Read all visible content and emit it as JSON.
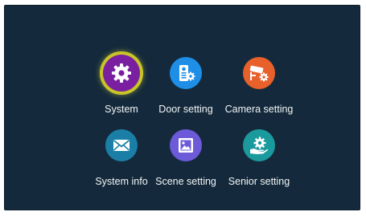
{
  "menu": {
    "items": [
      {
        "label": "System",
        "icon": "gear-icon",
        "color": "#7a1fa0",
        "selected": true
      },
      {
        "label": "Door setting",
        "icon": "door-phone-icon",
        "color": "#1e8ee6",
        "selected": false
      },
      {
        "label": "Camera setting",
        "icon": "security-camera-icon",
        "color": "#e8602a",
        "selected": false
      },
      {
        "label": "System info",
        "icon": "envelope-icon",
        "color": "#1b7ea6",
        "selected": false
      },
      {
        "label": "Scene setting",
        "icon": "picture-icon",
        "color": "#6c5ad8",
        "selected": false
      },
      {
        "label": "Senior setting",
        "icon": "hand-gear-icon",
        "color": "#1b9a9e",
        "selected": false
      }
    ]
  }
}
